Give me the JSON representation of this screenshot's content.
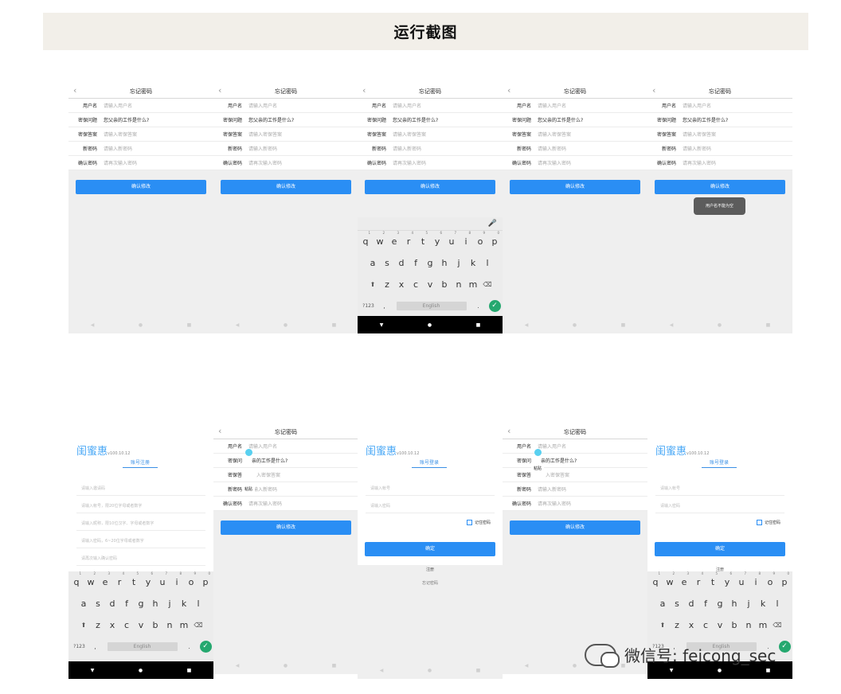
{
  "banner": {
    "title": "运行截图"
  },
  "forgot": {
    "title": "忘记密码",
    "labels": {
      "username": "用户名",
      "question": "密保问题",
      "answer": "密保答案",
      "new_pwd": "新密码",
      "confirm_pwd": "确认密码"
    },
    "placeholders": {
      "username": "请输入用户名",
      "answer": "请输入密保答案",
      "new_pwd": "请输入新密码",
      "confirm_pwd": "请再次输入密码"
    },
    "question_value": "您父亲的工作是什么?",
    "button": "确认修改",
    "toast": "用户名不能为空",
    "paste": "粘贴",
    "q_obscured": "亲的工作是什么?",
    "answer_obscured": "入密保答案",
    "lab_q_short": "密保问",
    "lab_a_short": "密保答"
  },
  "keyboard": {
    "row1": [
      "q",
      "w",
      "e",
      "r",
      "t",
      "y",
      "u",
      "i",
      "o",
      "p"
    ],
    "row1_nums": [
      "1",
      "2",
      "3",
      "4",
      "5",
      "6",
      "7",
      "8",
      "9",
      "0"
    ],
    "row2": [
      "a",
      "s",
      "d",
      "f",
      "g",
      "h",
      "j",
      "k",
      "l"
    ],
    "row3": [
      "z",
      "x",
      "c",
      "v",
      "b",
      "n",
      "m"
    ],
    "sym": "?123",
    "comma": ",",
    "space": "English",
    "period": "."
  },
  "app": {
    "name": "闺蜜惠",
    "version": "v100.10.12",
    "register_tab": "账号注册",
    "login_tab": "账号登录",
    "register_fields": [
      "请输入邀请码",
      "请输入帐号，限20位字母或者数字",
      "请输入昵称，限10位汉字、字母或者数字",
      "请输入密码，6~20位字母或者数字",
      "请再次输入确认密码"
    ],
    "login_fields": [
      "请输入帐号",
      "请输入密码"
    ],
    "remember": "记住密码",
    "ok": "确定",
    "register_link": "注册",
    "forgot_link": "忘记密码"
  },
  "watermark": {
    "text": "微信号: feicong_sec"
  },
  "colors": {
    "accent": "#2a8ef4",
    "banner_bg": "#f2efe9",
    "ok_key": "#25a86f"
  },
  "icons": [
    "back-arrow-icon",
    "mic-icon",
    "shift-icon",
    "backspace-icon",
    "check-icon",
    "nav-back-icon",
    "nav-home-icon",
    "nav-recent-icon",
    "keyboard-hide-icon",
    "wechat-icon"
  ]
}
